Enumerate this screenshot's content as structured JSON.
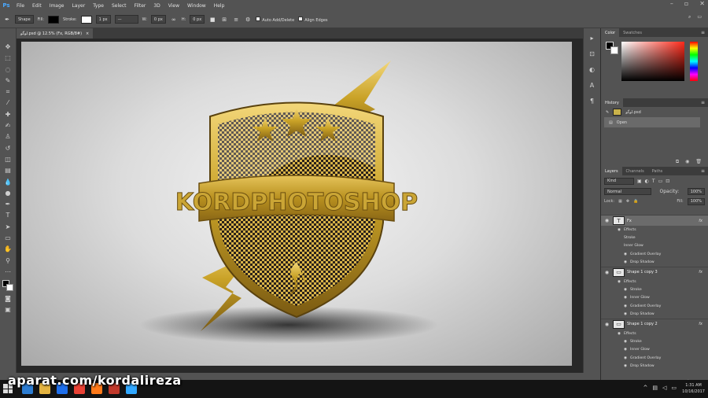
{
  "app": {
    "logo": "Ps"
  },
  "menu": [
    "File",
    "Edit",
    "Image",
    "Layer",
    "Type",
    "Select",
    "Filter",
    "3D",
    "View",
    "Window",
    "Help"
  ],
  "options": {
    "tool_mode": "Shape",
    "fill_label": "Fill:",
    "stroke_label": "Stroke:",
    "stroke_width": "1 px",
    "w_label": "W:",
    "w_value": "0 px",
    "h_label": "H:",
    "h_value": "0 px",
    "auto_add_delete": "Auto Add/Delete",
    "align_edges": "Align Edges"
  },
  "document": {
    "tab_title": "لوگو.psd @ 12.5% (Fx, RGB/8#)",
    "close_glyph": "×"
  },
  "canvas": {
    "logo_text": "KORDPHOTOSHOP"
  },
  "color_panel": {
    "tabs": [
      "Color",
      "Swatches"
    ]
  },
  "history_panel": {
    "tab": "History",
    "snapshot": "لوگو.psd",
    "entries": [
      "Open"
    ]
  },
  "layers_panel": {
    "tabs": [
      "Layers",
      "Channels",
      "Paths"
    ],
    "filter": "Kind",
    "blend_mode": "Normal",
    "opacity_label": "Opacity:",
    "opacity": "100%",
    "lock_label": "Lock:",
    "fill_label": "Fill:",
    "fill": "100%",
    "layers": [
      {
        "name": "Fx",
        "thumb": "T",
        "fx": "fx",
        "effects": [
          "Effects",
          "Stroke",
          "Inner Glow",
          "Gradient Overlay",
          "Drop Shadow"
        ],
        "active": true
      },
      {
        "name": "Shape 1 copy 3",
        "thumb": "▭",
        "fx": "fx",
        "effects": [
          "Effects",
          "Stroke",
          "Inner Glow",
          "Gradient Overlay",
          "Drop Shadow"
        ]
      },
      {
        "name": "Shape 1 copy 2",
        "thumb": "▭",
        "fx": "fx",
        "effects": [
          "Effects",
          "Stroke",
          "Inner Glow",
          "Gradient Overlay",
          "Drop Shadow"
        ]
      }
    ]
  },
  "taskbar": {
    "time": "1:31 AM",
    "date": "10/16/2017"
  },
  "watermark": "aparat.com/kordalireza",
  "colors": {
    "accent_blue": "#4aa9ff",
    "gold": "#c9a227"
  }
}
